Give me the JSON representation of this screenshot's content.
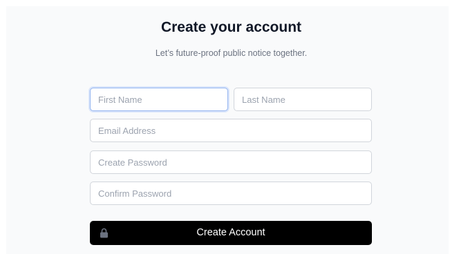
{
  "header": {
    "title": "Create your account",
    "subtitle": "Let’s future-proof public notice together."
  },
  "form": {
    "first_name": {
      "placeholder": "First Name",
      "value": ""
    },
    "last_name": {
      "placeholder": "Last Name",
      "value": ""
    },
    "email": {
      "placeholder": "Email Address",
      "value": ""
    },
    "password": {
      "placeholder": "Create Password",
      "value": ""
    },
    "confirm_password": {
      "placeholder": "Confirm Password",
      "value": ""
    },
    "submit_label": "Create Account",
    "submit_icon": "lock-icon"
  },
  "colors": {
    "panel_background": "#f9fafb",
    "button_background": "#000000",
    "focus_ring": "#93b4f0"
  }
}
